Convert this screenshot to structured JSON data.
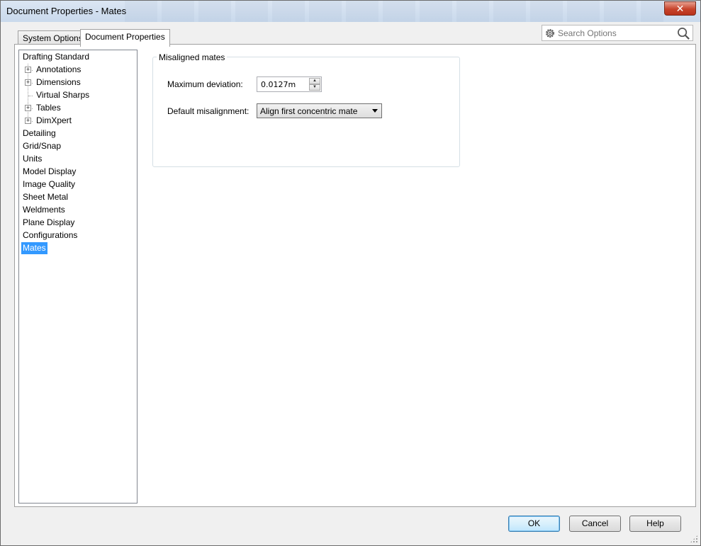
{
  "window": {
    "title": "Document Properties - Mates",
    "close_glyph": "✕"
  },
  "tabs": [
    {
      "label": "System Options"
    },
    {
      "label": "Document Properties",
      "active": true
    }
  ],
  "search": {
    "placeholder": "Search Options"
  },
  "tree": {
    "items": [
      {
        "label": "Drafting Standard"
      },
      {
        "label": "Annotations",
        "child": true,
        "expandable": true
      },
      {
        "label": "Dimensions",
        "child": true,
        "expandable": true
      },
      {
        "label": "Virtual Sharps",
        "child": true
      },
      {
        "label": "Tables",
        "child": true,
        "expandable": true
      },
      {
        "label": "DimXpert",
        "child": true,
        "expandable": true
      },
      {
        "label": "Detailing"
      },
      {
        "label": "Grid/Snap"
      },
      {
        "label": "Units"
      },
      {
        "label": "Model Display"
      },
      {
        "label": "Image Quality"
      },
      {
        "label": "Sheet Metal"
      },
      {
        "label": "Weldments"
      },
      {
        "label": "Plane Display"
      },
      {
        "label": "Configurations"
      },
      {
        "label": "Mates",
        "selected": true
      }
    ],
    "expander_glyph": "+"
  },
  "misaligned": {
    "group_title": "Misaligned mates",
    "max_dev_label": "Maximum deviation:",
    "max_dev_value": "0.0127m",
    "default_label": "Default misalignment:",
    "default_value": "Align first concentric mate",
    "spin_up_glyph": "▲",
    "spin_down_glyph": "▼"
  },
  "buttons": {
    "ok": "OK",
    "cancel": "Cancel",
    "help": "Help"
  },
  "colors": {
    "selection": "#3399ff",
    "close_button": "#c7432b"
  }
}
